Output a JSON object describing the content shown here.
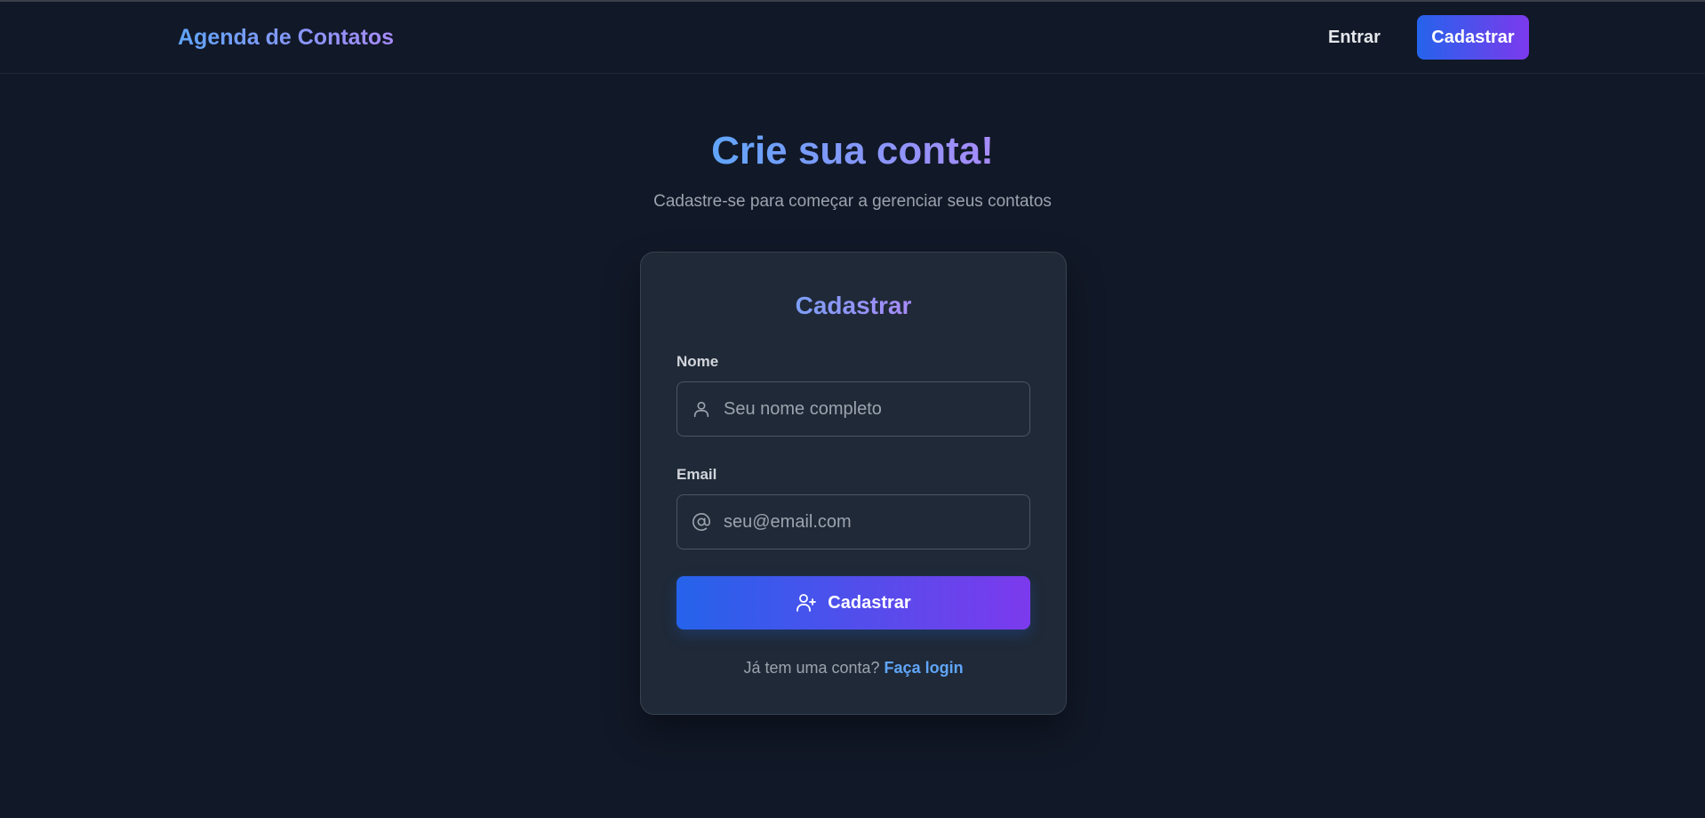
{
  "header": {
    "brand": "Agenda de Contatos",
    "login_label": "Entrar",
    "signup_label": "Cadastrar"
  },
  "hero": {
    "title": "Crie sua conta!",
    "subtitle": "Cadastre-se para começar a gerenciar seus contatos"
  },
  "form": {
    "title": "Cadastrar",
    "name_label": "Nome",
    "name_placeholder": "Seu nome completo",
    "name_icon": "user-icon",
    "email_label": "Email",
    "email_placeholder": "seu@email.com",
    "email_icon": "at-sign-icon",
    "submit_label": "Cadastrar",
    "submit_icon": "user-plus-icon",
    "footer_text": "Já tem uma conta?",
    "footer_link": "Faça login"
  },
  "colors": {
    "background": "#111827",
    "card": "#1f2937",
    "gradient_start": "#2563eb",
    "gradient_end": "#7c3aed",
    "link": "#60a5fa"
  }
}
